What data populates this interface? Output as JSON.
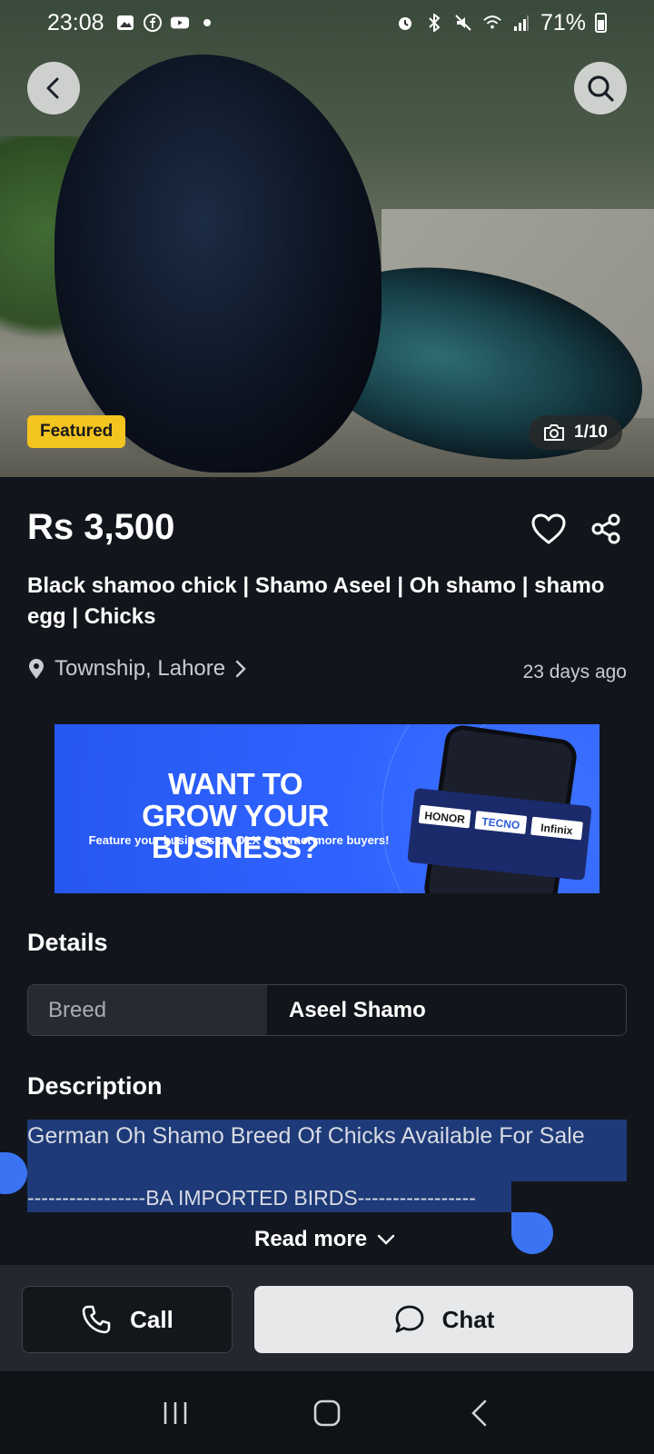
{
  "status_bar": {
    "time": "23:08",
    "battery": "71%",
    "left_icons": [
      "gallery-icon",
      "facebook-icon",
      "youtube-icon",
      "dot-icon"
    ],
    "right_icons": [
      "alarm-icon",
      "bluetooth-icon",
      "mute-icon",
      "wifi-icon",
      "signal-icon",
      "battery-icon"
    ]
  },
  "hero": {
    "featured_badge": "Featured",
    "photo_counter": "1/10"
  },
  "listing": {
    "price": "Rs 3,500",
    "title": "Black shamoo chick | Shamo Aseel | Oh shamo | shamo egg  | Chicks",
    "location": "Township, Lahore",
    "posted": "23 days ago"
  },
  "banner": {
    "headline_line1": "WANT TO",
    "headline_line2": "GROW YOUR BUSINESS?",
    "subtext": "Feature your business on OLX & attract more buyers!",
    "brands": [
      "HONOR",
      "TECNO",
      "Infinix"
    ]
  },
  "details": {
    "heading": "Details",
    "rows": [
      {
        "key": "Breed",
        "value": "Aseel Shamo"
      }
    ]
  },
  "description": {
    "heading": "Description",
    "line1": "German Oh Shamo Breed Of Chicks Available For Sale",
    "line2": "-----------------BA IMPORTED BIRDS-----------------",
    "read_more": "Read more"
  },
  "actions": {
    "call_label": "Call",
    "chat_label": "Chat"
  },
  "colors": {
    "background": "#12161c",
    "featured": "#f4c41f",
    "selection": "#1f3a78",
    "selection_handle": "#3a74f2",
    "chat_button": "#e7e8ea"
  }
}
